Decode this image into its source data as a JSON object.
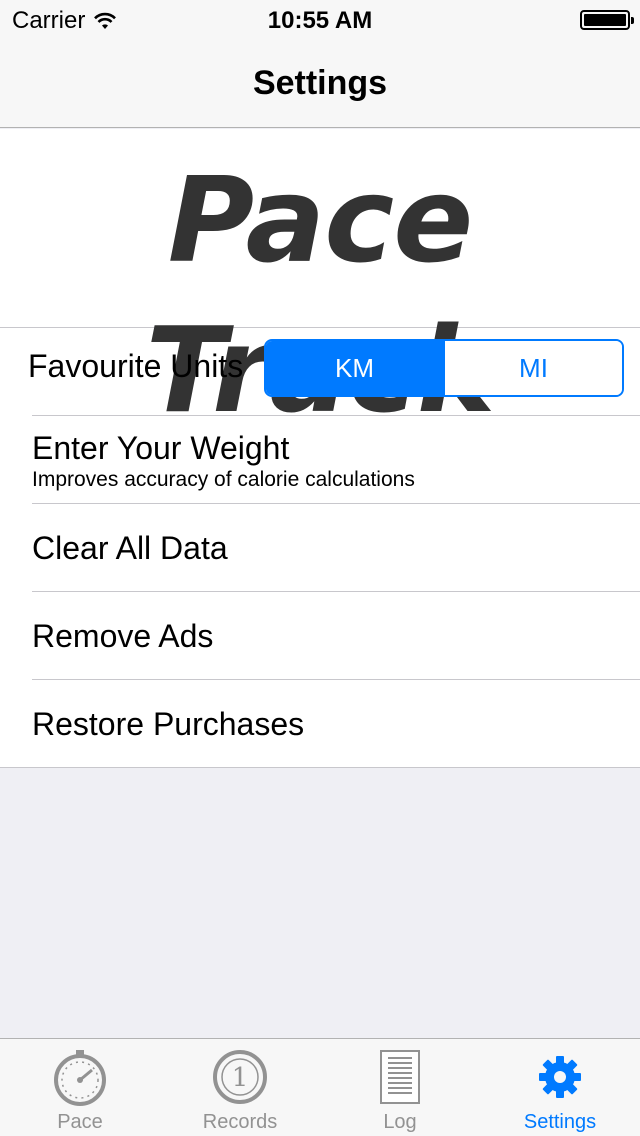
{
  "status_bar": {
    "carrier": "Carrier",
    "time": "10:55 AM"
  },
  "nav": {
    "title": "Settings"
  },
  "logo": {
    "text": "Pace Track"
  },
  "settings": {
    "units": {
      "label": "Favourite Units",
      "options": [
        "KM",
        "MI"
      ],
      "selected": "KM"
    },
    "weight": {
      "label": "Enter Your Weight",
      "subtitle": "Improves accuracy of calorie calculations"
    },
    "clear_data": {
      "label": "Clear All Data"
    },
    "remove_ads": {
      "label": "Remove Ads"
    },
    "restore": {
      "label": "Restore Purchases"
    }
  },
  "tabs": [
    {
      "label": "Pace",
      "icon": "stopwatch-icon",
      "active": false
    },
    {
      "label": "Records",
      "icon": "record-number-icon",
      "active": false,
      "icon_text": "1"
    },
    {
      "label": "Log",
      "icon": "document-icon",
      "active": false
    },
    {
      "label": "Settings",
      "icon": "gear-icon",
      "active": true
    }
  ],
  "colors": {
    "accent": "#007aff",
    "inactive": "#929292",
    "logo": "#333333",
    "background": "#efeff4"
  }
}
